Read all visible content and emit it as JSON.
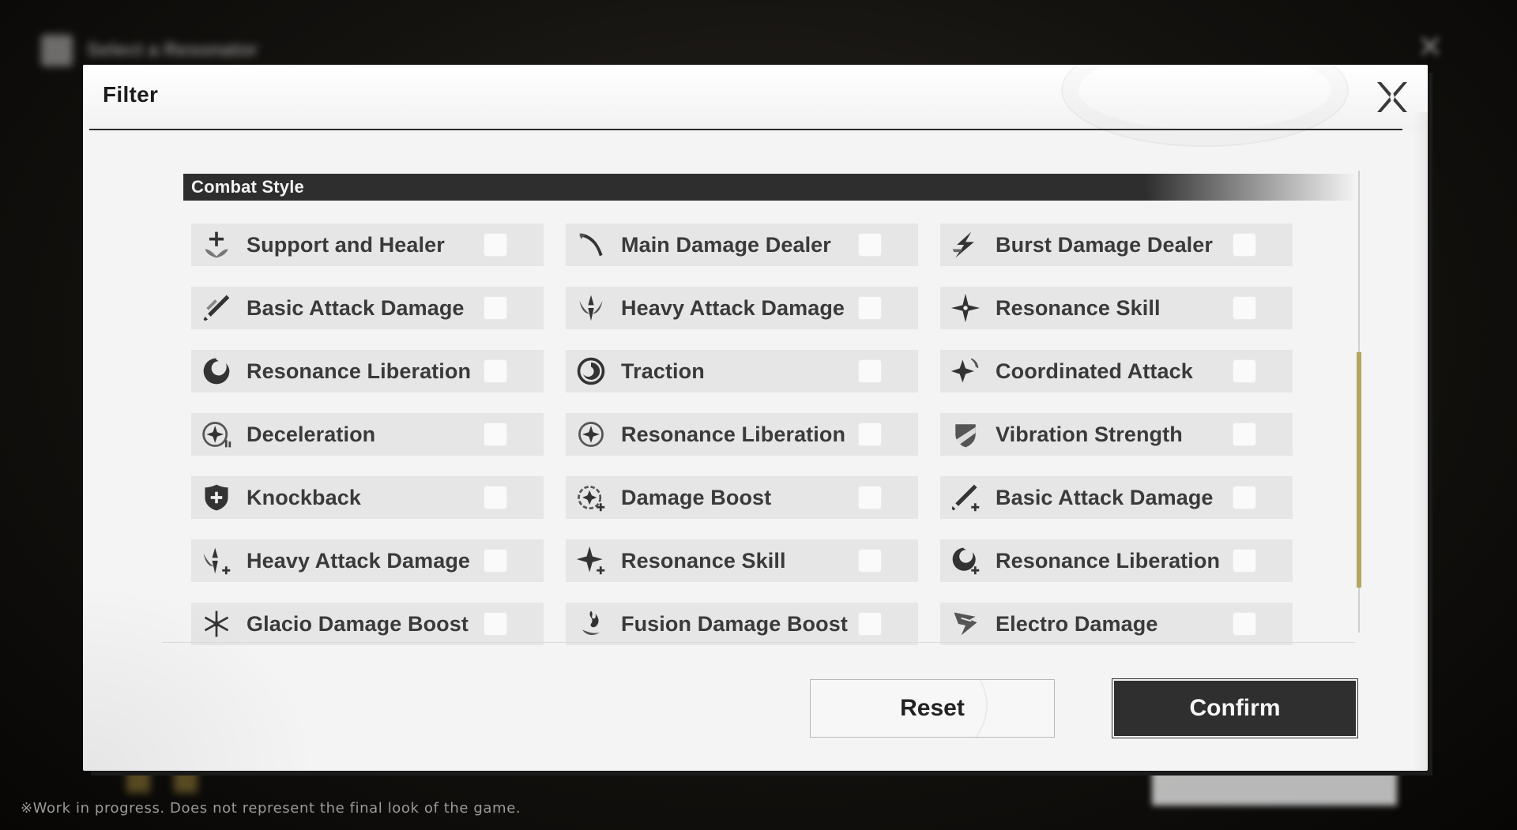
{
  "background": {
    "title": "Select a Resonator"
  },
  "modal": {
    "title": "Filter",
    "section_title": "Combat Style",
    "options": [
      {
        "label": "Support and Healer",
        "icon": "support-healer-icon"
      },
      {
        "label": "Main Damage Dealer",
        "icon": "main-damage-icon"
      },
      {
        "label": "Burst Damage Dealer",
        "icon": "burst-damage-icon"
      },
      {
        "label": "Basic Attack Damage",
        "icon": "basic-attack-icon"
      },
      {
        "label": "Heavy Attack Damage",
        "icon": "heavy-attack-icon"
      },
      {
        "label": "Resonance Skill",
        "icon": "resonance-skill-icon"
      },
      {
        "label": "Resonance Liberation",
        "icon": "resonance-liberation-icon"
      },
      {
        "label": "Traction",
        "icon": "traction-icon"
      },
      {
        "label": "Coordinated Attack",
        "icon": "coordinated-attack-icon"
      },
      {
        "label": "Deceleration",
        "icon": "deceleration-icon"
      },
      {
        "label": "Resonance Liberation",
        "icon": "resonance-liberation-alt-icon"
      },
      {
        "label": "Vibration Strength",
        "icon": "vibration-strength-icon"
      },
      {
        "label": "Knockback",
        "icon": "knockback-icon"
      },
      {
        "label": "Damage Boost",
        "icon": "damage-boost-icon"
      },
      {
        "label": "Basic Attack Damage",
        "icon": "basic-attack-plus-icon"
      },
      {
        "label": "Heavy Attack Damage",
        "icon": "heavy-attack-plus-icon"
      },
      {
        "label": "Resonance Skill",
        "icon": "resonance-skill-plus-icon"
      },
      {
        "label": "Resonance Liberation",
        "icon": "resonance-liberation-plus-icon"
      },
      {
        "label": "Glacio Damage Boost",
        "icon": "glacio-icon"
      },
      {
        "label": "Fusion Damage Boost",
        "icon": "fusion-icon"
      },
      {
        "label": "Electro Damage",
        "icon": "electro-icon"
      }
    ],
    "reset_label": "Reset",
    "confirm_label": "Confirm"
  },
  "disclaimer": "※Work in progress. Does not represent the final look of the game.",
  "colors": {
    "accent_scroll": "#b4a45f",
    "panel": "#f4f4f4",
    "dark": "#2f2f2f"
  }
}
